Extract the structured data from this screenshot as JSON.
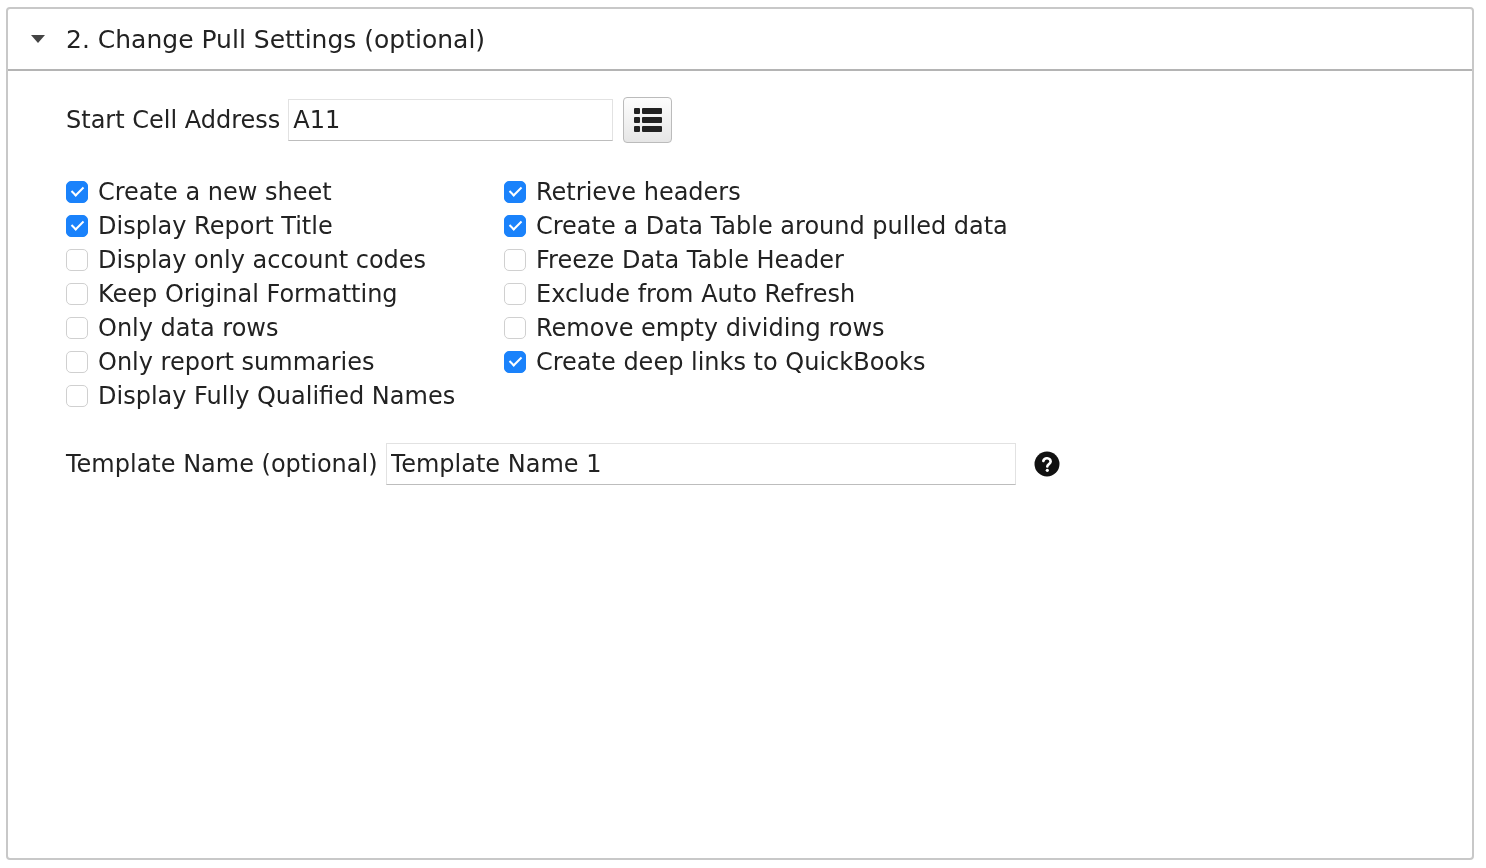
{
  "section": {
    "title": "2. Change Pull Settings (optional)",
    "expanded": true
  },
  "start_cell": {
    "label": "Start Cell Address",
    "value": "A11"
  },
  "option_columns": [
    [
      {
        "label": "Create a new sheet",
        "checked": true
      },
      {
        "label": "Display Report Title",
        "checked": true
      },
      {
        "label": "Display only account codes",
        "checked": false
      },
      {
        "label": "Keep Original Formatting",
        "checked": false
      },
      {
        "label": "Only data rows",
        "checked": false
      },
      {
        "label": "Only report summaries",
        "checked": false
      },
      {
        "label": "Display Fully Qualified Names",
        "checked": false
      }
    ],
    [
      {
        "label": "Retrieve headers",
        "checked": true
      },
      {
        "label": "Create a Data Table around pulled data",
        "checked": true
      },
      {
        "label": "Freeze Data Table Header",
        "checked": false
      },
      {
        "label": "Exclude from Auto Refresh",
        "checked": false
      },
      {
        "label": "Remove empty dividing rows",
        "checked": false
      },
      {
        "label": "Create deep links to QuickBooks",
        "checked": true
      }
    ]
  ],
  "template_name": {
    "label": "Template Name (optional)",
    "value": "Template Name 1"
  }
}
